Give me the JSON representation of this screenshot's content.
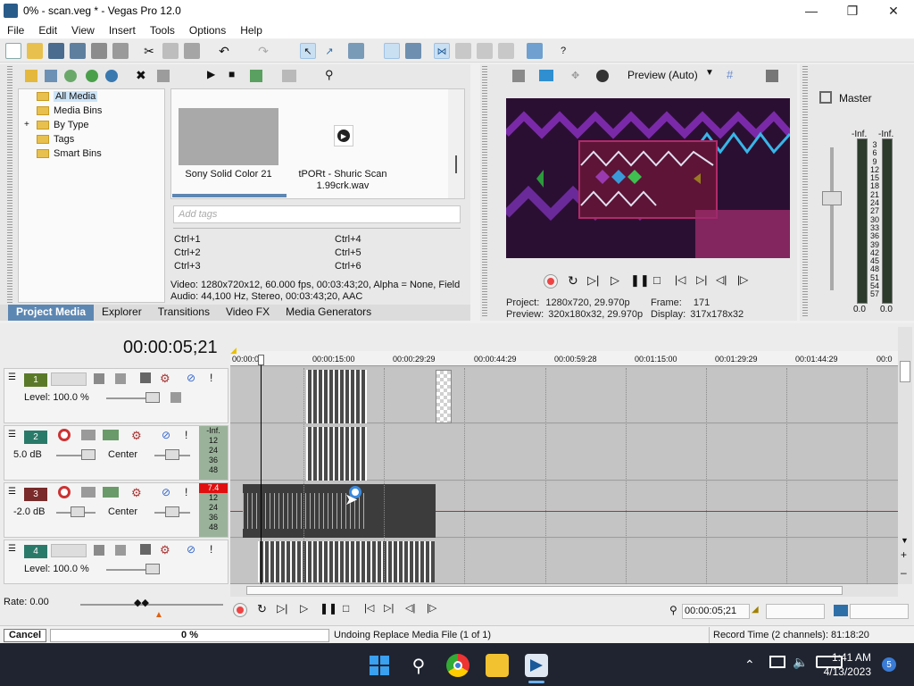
{
  "window": {
    "title": "0% - scan.veg * - Vegas Pro 12.0"
  },
  "menu": [
    "File",
    "Edit",
    "View",
    "Insert",
    "Tools",
    "Options",
    "Help"
  ],
  "explorer": {
    "tree": [
      "All Media",
      "Media Bins",
      "By Type",
      "Tags",
      "Smart Bins"
    ],
    "media": [
      {
        "name": "Sony Solid Color 21"
      },
      {
        "name": "tPORt - Shuric Scan 1.99crk.wav"
      }
    ],
    "tags_placeholder": "Add tags",
    "shortcuts": [
      "Ctrl+1",
      "Ctrl+2",
      "Ctrl+3",
      "Ctrl+4",
      "Ctrl+5",
      "Ctrl+6"
    ],
    "info_video": "Video: 1280x720x12, 60.000 fps, 00:03:43;20, Alpha = None, Field",
    "info_audio": "Audio: 44,100 Hz, Stereo, 00:03:43;20, AAC",
    "tabs": [
      "Project Media",
      "Explorer",
      "Transitions",
      "Video FX",
      "Media Generators"
    ]
  },
  "preview": {
    "mode": "Preview (Auto)",
    "project_label": "Project:",
    "project_value": "1280x720, 29.970p",
    "preview_label": "Preview:",
    "preview_value": "320x180x32, 29.970p",
    "frame_label": "Frame:",
    "frame_value": "171",
    "display_label": "Display:",
    "display_value": "317x178x32"
  },
  "master": {
    "title": "Master",
    "inf_left": "-Inf.",
    "inf_right": "-Inf.",
    "scale": [
      "3",
      "6",
      "9",
      "12",
      "15",
      "18",
      "21",
      "24",
      "27",
      "30",
      "33",
      "36",
      "39",
      "42",
      "45",
      "48",
      "51",
      "54",
      "57"
    ],
    "val_left": "0.0",
    "val_right": "0.0"
  },
  "timeline": {
    "timecode": "00:00:05;21",
    "ruler": [
      "00:00:00",
      "00:00:15:00",
      "00:00:29:29",
      "00:00:44:29",
      "00:00:59:28",
      "00:01:15:00",
      "00:01:29:29",
      "00:01:44:29",
      "00:0"
    ],
    "tracks": [
      {
        "num": "1",
        "kind": "video",
        "label": "Level: 100.0 %"
      },
      {
        "num": "2",
        "kind": "audio",
        "vol": "5.0 dB",
        "pan": "Center",
        "meter": [
          "-Inf.",
          "12",
          "24",
          "36",
          "48"
        ]
      },
      {
        "num": "3",
        "kind": "audio",
        "vol": "-2.0 dB",
        "pan": "Center",
        "meter": [
          "7.4",
          "12",
          "24",
          "36",
          "48"
        ]
      },
      {
        "num": "4",
        "kind": "video",
        "label": "Level: 100.0 %"
      }
    ],
    "rate": "Rate: 0.00",
    "cursor_time": "00:00:05;21"
  },
  "statusbar": {
    "cancel": "Cancel",
    "progress": "0 %",
    "progress_fraction": 0.0,
    "message": "Undoing Replace Media File (1 of 1)",
    "record": "Record Time (2 channels): 81:18:20"
  },
  "taskbar": {
    "time": "1:41 AM",
    "date": "4/13/2023"
  }
}
